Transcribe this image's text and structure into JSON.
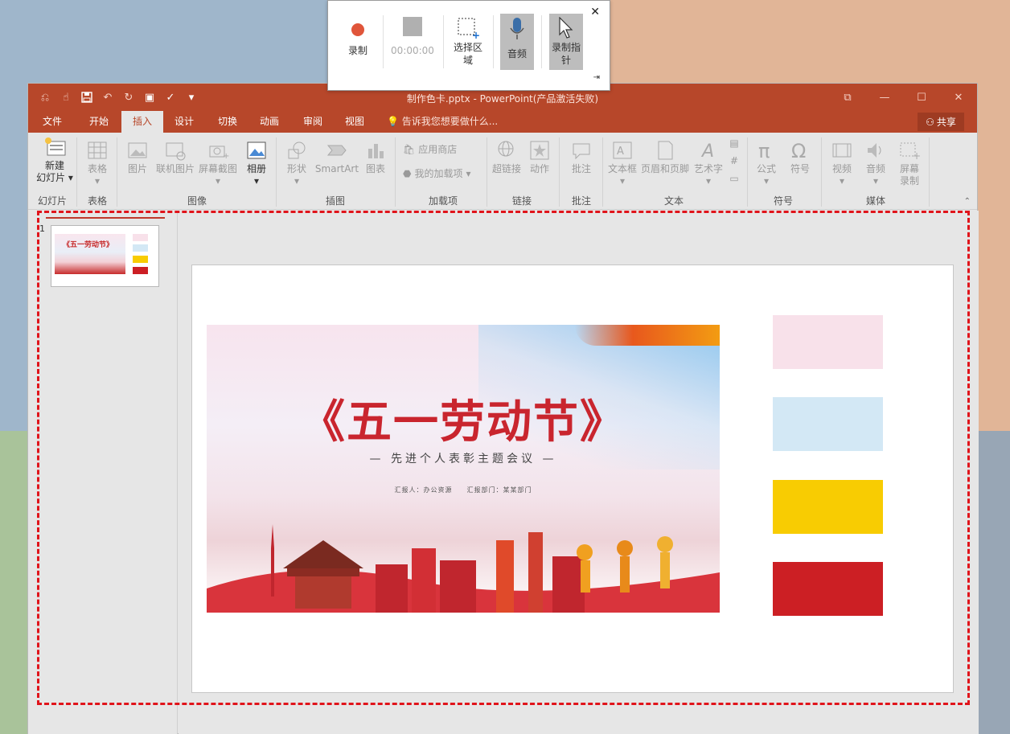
{
  "recorder": {
    "record_label": "录制",
    "timer": "00:00:00",
    "select_area_label": "选择区域",
    "audio_label": "音频",
    "record_pointer_label": "录制指针",
    "close_glyph": "✕",
    "pin_glyph": "⇥"
  },
  "window": {
    "title": "制作色卡.pptx - PowerPoint(产品激活失败)",
    "controls": [
      "⧉",
      "—",
      "☐",
      "✕"
    ]
  },
  "tabs": [
    {
      "label": "文件"
    },
    {
      "label": "开始"
    },
    {
      "label": "插入"
    },
    {
      "label": "设计"
    },
    {
      "label": "切换"
    },
    {
      "label": "动画"
    },
    {
      "label": "审阅"
    },
    {
      "label": "视图"
    }
  ],
  "active_tab": "插入",
  "tell_me": "告诉我您想要做什么...",
  "share_label": "共享",
  "ribbon": {
    "slides": {
      "new_slide": "新建",
      "new_slide2": "幻灯片",
      "group": "幻灯片"
    },
    "tables": {
      "table": "表格",
      "group": "表格"
    },
    "images": {
      "picture": "图片",
      "online_picture": "联机图片",
      "screenshot": "屏幕截图",
      "album": "相册",
      "group": "图像"
    },
    "illustrations": {
      "shapes": "形状",
      "smartart": "SmartArt",
      "chart": "图表",
      "group": "插图"
    },
    "addins": {
      "store": "应用商店",
      "my_addins": "我的加载项",
      "group": "加载项"
    },
    "links": {
      "hyperlink": "超链接",
      "action": "动作",
      "group": "链接"
    },
    "comments": {
      "comment": "批注",
      "group": "批注"
    },
    "text": {
      "textbox": "文本框",
      "header_footer": "页眉和页脚",
      "wordart": "艺术字",
      "group": "文本"
    },
    "symbols": {
      "equation": "公式",
      "symbol": "符号",
      "group": "符号"
    },
    "media": {
      "video": "视频",
      "audio": "音频",
      "screen_record": "屏幕",
      "screen_record2": "录制",
      "group": "媒体"
    }
  },
  "thumbnail": {
    "number": "1",
    "mini_title": "《五一劳动节》"
  },
  "slide": {
    "banner_title": "《五一劳动节》",
    "banner_subtitle": "— 先进个人表彰主题会议 —",
    "banner_info": "汇报人：办公资源　　汇报部门：某某部门",
    "swatches": [
      "#f8e1ea",
      "#d3e8f5",
      "#f8cc02",
      "#cc1f24"
    ]
  },
  "colors": {
    "accent": "#b7472a",
    "highlight_dash": "#e0141b"
  }
}
